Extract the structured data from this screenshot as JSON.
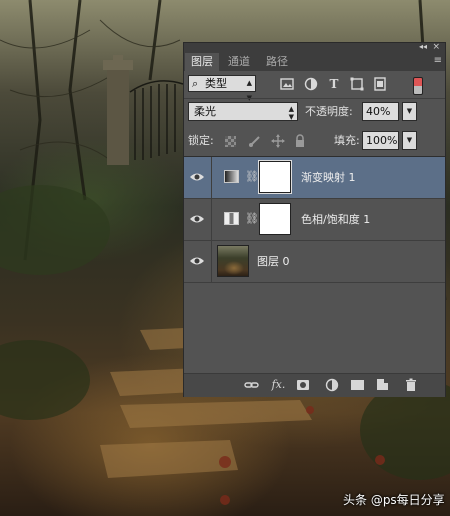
{
  "panel": {
    "tabs": [
      {
        "label": "图层",
        "active": true
      },
      {
        "label": "通道",
        "active": false
      },
      {
        "label": "路径",
        "active": false
      }
    ],
    "collapse_glyph": "◂◂",
    "close_glyph": "×",
    "menu_glyph": "≡",
    "filter": {
      "kind_label": "类型",
      "icons": [
        "image-filter-icon",
        "adjustment-filter-icon",
        "type-filter-icon",
        "shape-filter-icon",
        "smart-object-filter-icon"
      ]
    },
    "blend": {
      "mode": "柔光",
      "opacity_label": "不透明度:",
      "opacity_value": "40%"
    },
    "lock": {
      "label": "锁定:",
      "icons": [
        "lock-transparent-icon",
        "lock-brush-icon",
        "lock-move-icon",
        "lock-all-icon"
      ],
      "fill_label": "填充:",
      "fill_value": "100%"
    },
    "layers": [
      {
        "name": "渐变映射 1",
        "type": "gradient-map",
        "visible": true,
        "selected": true
      },
      {
        "name": "色相/饱和度 1",
        "type": "hue-saturation",
        "visible": true,
        "selected": false
      },
      {
        "name": "图层 0",
        "type": "pixel",
        "visible": true,
        "selected": false
      }
    ],
    "bottom_icons": [
      "link-icon",
      "fx-icon",
      "add-mask-icon",
      "new-adjustment-icon",
      "new-group-icon",
      "new-layer-icon",
      "trash-icon"
    ]
  },
  "watermark": "头条 @ps每日分享",
  "colors": {
    "panel_bg": "#535353",
    "selected_row": "#5c6f88",
    "panel_header": "#3d3d3d"
  }
}
